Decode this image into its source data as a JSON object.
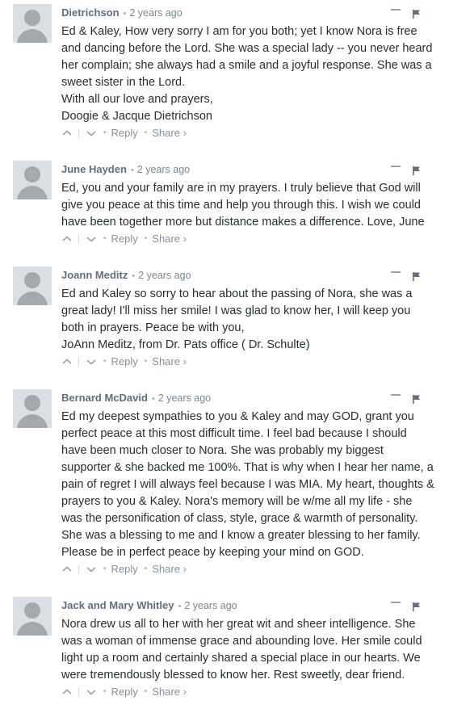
{
  "comments": [
    {
      "author": "Dietrichson",
      "time": "2 years ago",
      "text": "Ed & Kaley, How very sorry I am for you both; yet I know Nora is free and dancing before the Lord. She was a special lady -- you never heard her complain; she always had a smile and a joyful response. She was a sweet sister in the Lord.\nWith all our love and prayers,\nDoogie & Jacque Dietrichson",
      "reply_label": "Reply",
      "share_label": "Share ›"
    },
    {
      "author": "June Hayden",
      "time": "2 years ago",
      "text": "Ed, you and your family are in my prayers. I truly believe that God will give you peace at this time and help you through this. I wish we could have been together more but distance makes a difference. Love, June",
      "reply_label": "Reply",
      "share_label": "Share ›"
    },
    {
      "author": "Joann Meditz",
      "time": "2 years ago",
      "text": "Ed and Kaley so sorry to hear about the passing of Nora, she was a great lady! I'll miss her smile! I was glad to know her, I will keep you both in prayers. Peace be with you,\nJoAnn Meditz, from Dr. Pats office ( Dr. Schulte)",
      "reply_label": "Reply",
      "share_label": "Share ›"
    },
    {
      "author": "Bernard McDavid",
      "time": "2 years ago",
      "text": "Ed my deepest sympathies to you & Kaley and may GOD, grant you perfect peace at this most difficult time. I feel bad because I should have been much closer to Nora. She was probably my biggest supporter & she backed me 100%. That is why when I hear her name, a pain of regret I will always feel because I was MIA. My heart, thoughts & prayers to you & Kaley. Nora's memory will be w/me all my life - she was the personification of class, style, grace & warmth of personality. She was a blessing to me and I know a greater blessing to her family. Please be in perfect peace by keeping your mind on GOD.",
      "reply_label": "Reply",
      "share_label": "Share ›"
    },
    {
      "author": "Jack and Mary Whitley",
      "time": "2 years ago",
      "text": "Nora drew us all to her with her great wit and sheer intelligence. She was a woman of immense grace and abounding love. Her smile could light up a room and certainly shared a special place in our hearts. We were tremendously blessed to know her. Rest sweetly, dear friend.",
      "reply_label": "Reply",
      "share_label": "Share ›"
    }
  ],
  "icons": {
    "avatar": "default-avatar-icon",
    "collapse": "minus-icon",
    "flag": "flag-icon",
    "upvote": "chevron-up-icon",
    "downvote": "chevron-down-icon"
  },
  "colors": {
    "author": "#656c7a",
    "meta": "#9aa1a8",
    "text": "#2a2e2e",
    "avatar_bg": "#dbdfe4",
    "avatar_fg": "#a5a9ad",
    "flag": "#656c7a"
  }
}
